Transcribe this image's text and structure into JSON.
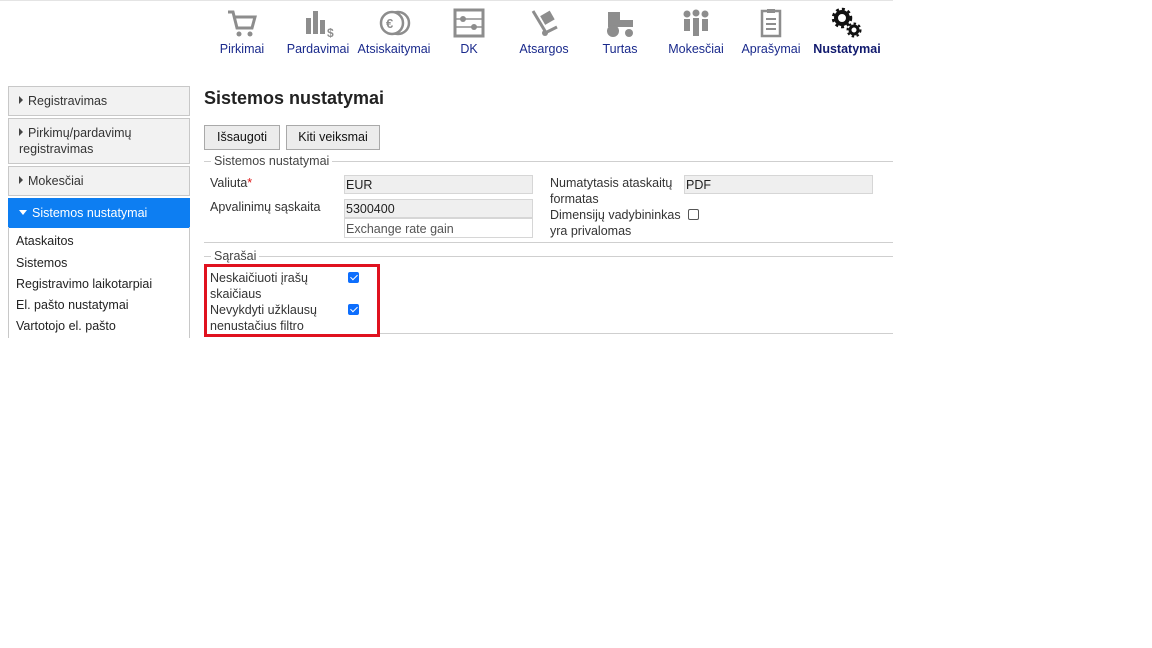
{
  "nav": {
    "items": [
      {
        "label": "Pirkimai",
        "icon": "shopping-cart-icon"
      },
      {
        "label": "Pardavimai",
        "icon": "sales-chart-icon"
      },
      {
        "label": "Atsiskaitymai",
        "icon": "coins-icon"
      },
      {
        "label": "DK",
        "icon": "abacus-icon"
      },
      {
        "label": "Atsargos",
        "icon": "hand-truck-icon"
      },
      {
        "label": "Turtas",
        "icon": "tractor-icon"
      },
      {
        "label": "Mokesčiai",
        "icon": "people-icon"
      },
      {
        "label": "Aprašymai",
        "icon": "clipboard-icon"
      },
      {
        "label": "Nustatymai",
        "icon": "gears-icon",
        "active": true
      }
    ]
  },
  "sidebar": {
    "items": [
      {
        "label": "Registravimas"
      },
      {
        "label": "Pirkimų/pardavimų registravimas"
      },
      {
        "label": "Mokesčiai"
      },
      {
        "label": "Sistemos nustatymai",
        "active": true
      }
    ],
    "subitems": [
      "Ataskaitos",
      "Sistemos",
      "Registravimo laikotarpiai",
      "El. pašto nustatymai",
      "Vartotojo el. pašto"
    ]
  },
  "page": {
    "title": "Sistemos nustatymai",
    "buttons": {
      "save": "Išsaugoti",
      "other": "Kiti veiksmai"
    }
  },
  "settings": {
    "legend": "Sistemos nustatymai",
    "currency_label": "Valiuta",
    "currency_required_mark": "*",
    "currency_value": "EUR",
    "rounding_label": "Apvalinimų sąskaita",
    "rounding_value": "5300400",
    "rounding_desc": "Exchange rate gain",
    "report_format_label": "Numatytasis ataskaitų formatas",
    "report_format_value": "PDF",
    "dimension_label": "Dimensijų vadybininkas yra privalomas",
    "dimension_checked": false
  },
  "lists": {
    "legend": "Sąrašai",
    "no_count_label": "Neskaičiuoti įrašų skaičiaus",
    "no_count_checked": true,
    "no_query_label": "Nevykdyti užklausų nenustačius filtro",
    "no_query_checked": true
  },
  "colors": {
    "accent": "#0d7ef2",
    "nav_text": "#1a2a8c",
    "highlight": "#e0121f",
    "required": "#dd1111"
  }
}
